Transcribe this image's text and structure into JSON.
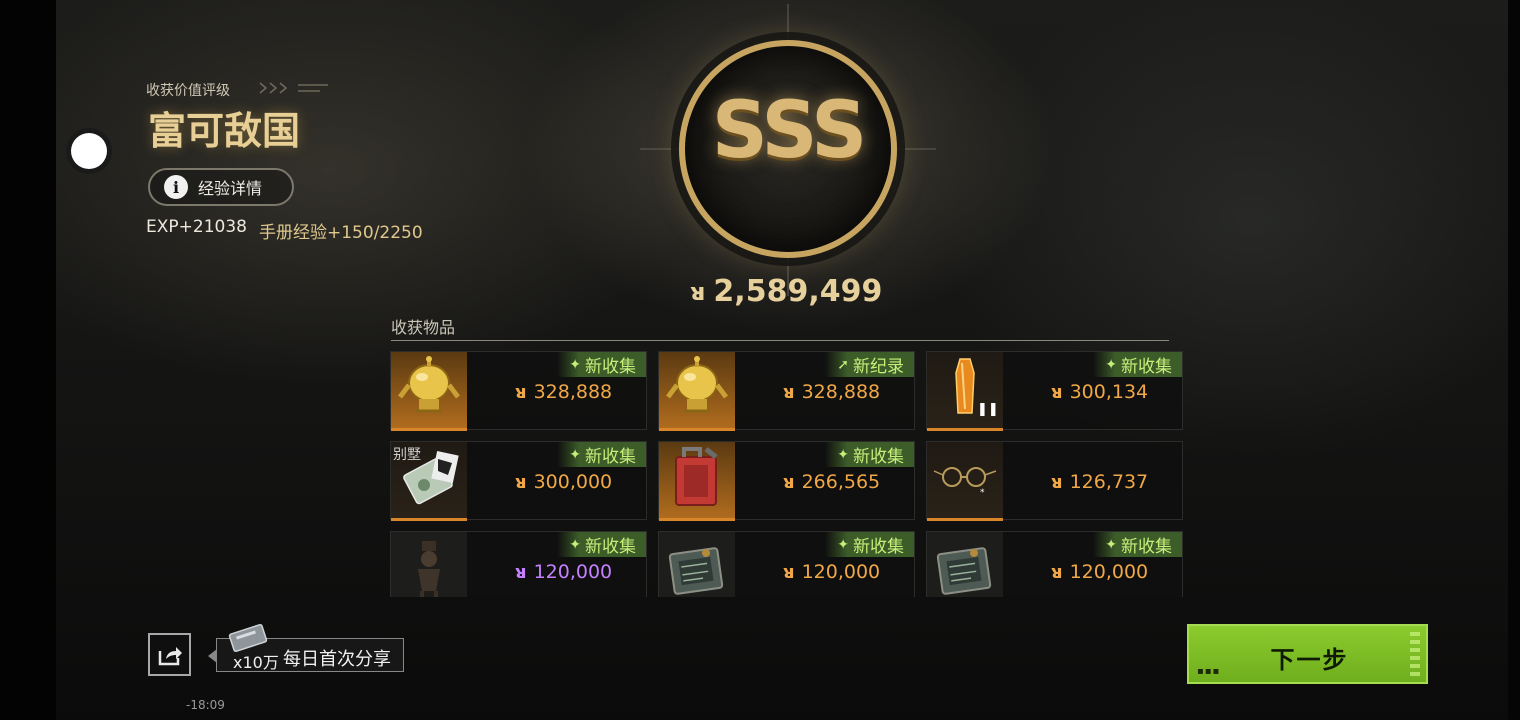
{
  "rating": {
    "subtitle": "收获价值评级",
    "title": "富可敌国"
  },
  "exp_details_button": "经验详情",
  "exp_line": "EXP+21038",
  "manual_exp": "手册经验+150/2250",
  "grade": "SSS",
  "total_value": "2,589,499",
  "items_section_label": "收获物品",
  "items": [
    {
      "tag": "新收集",
      "tag_icon": "sparkle-icon",
      "value": "328,888",
      "value_color": "#f0a747",
      "thumb": "gold",
      "icon": "golden-robot-statue-icon"
    },
    {
      "tag": "新纪录",
      "tag_icon": "arrow-up-icon",
      "value": "328,888",
      "value_color": "#f0a747",
      "thumb": "gold",
      "icon": "golden-robot-statue-icon"
    },
    {
      "tag": "新收集",
      "tag_icon": "sparkle-icon",
      "value": "300,134",
      "value_color": "#f0a747",
      "thumb": "dark",
      "icon": "amber-crystal-icon"
    },
    {
      "tag": "新收集",
      "tag_icon": "sparkle-icon",
      "value": "300,000",
      "value_color": "#f0a747",
      "thumb": "dark",
      "thumb_label": "别墅",
      "icon": "villa-keycard-icon"
    },
    {
      "tag": "新收集",
      "tag_icon": "sparkle-icon",
      "value": "266,565",
      "value_color": "#f0a747",
      "thumb": "gold",
      "icon": "red-jerrycan-icon"
    },
    {
      "tag": "",
      "tag_icon": "",
      "value": "126,737",
      "value_color": "#f0a747",
      "thumb": "dark",
      "icon": "round-glasses-icon"
    },
    {
      "tag": "新收集",
      "tag_icon": "sparkle-icon",
      "value": "120,000",
      "value_color": "#c480ff",
      "thumb": "none",
      "icon": "antique-figurine-icon"
    },
    {
      "tag": "新收集",
      "tag_icon": "sparkle-icon",
      "value": "120,000",
      "value_color": "#f0a747",
      "thumb": "none",
      "icon": "circuit-module-icon"
    },
    {
      "tag": "新收集",
      "tag_icon": "sparkle-icon",
      "value": "120,000",
      "value_color": "#f0a747",
      "thumb": "none",
      "icon": "circuit-module-icon"
    }
  ],
  "share": {
    "count": "x10万",
    "text": "每日首次分享"
  },
  "clock": "-18:09",
  "next_button": "下一步",
  "colors": {
    "gold": "#d9b877",
    "orange_value": "#f0a747",
    "purple_value": "#c480ff",
    "new_tag": "#c6ef7a",
    "accent_green": "#8ccc2e"
  }
}
